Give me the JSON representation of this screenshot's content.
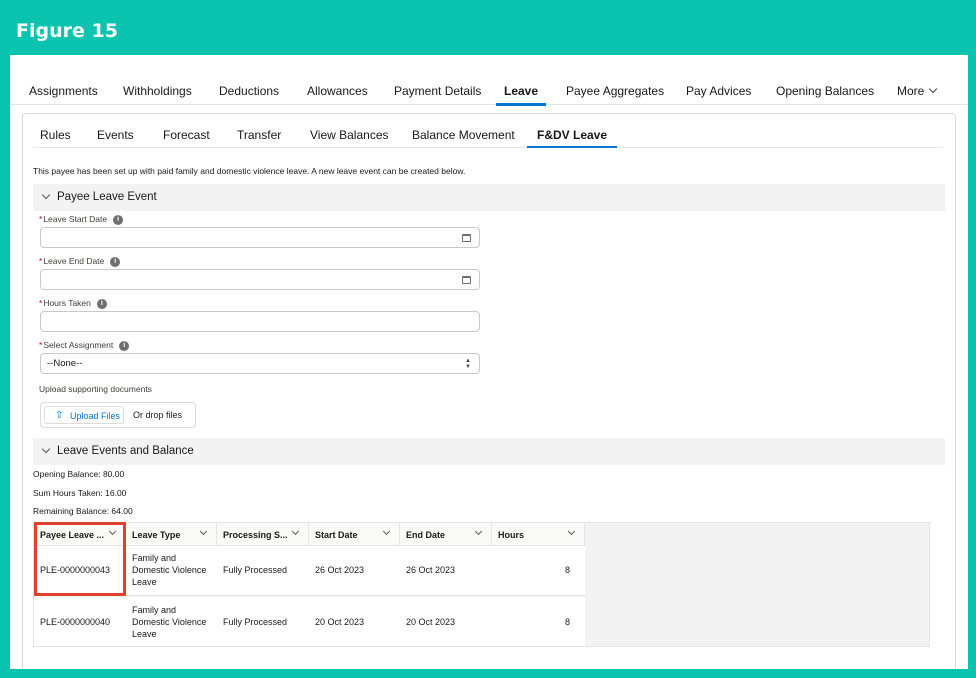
{
  "figure_title": "Figure 15",
  "top_tabs": [
    "Assignments",
    "Withholdings",
    "Deductions",
    "Allowances",
    "Payment Details",
    "Leave",
    "Payee Aggregates",
    "Pay Advices",
    "Opening Balances",
    "More"
  ],
  "active_top_tab": "Leave",
  "sub_tabs": [
    "Rules",
    "Events",
    "Forecast",
    "Transfer",
    "View Balances",
    "Balance Movement",
    "F&DV Leave"
  ],
  "active_sub_tab": "F&DV Leave",
  "intro_text": "This payee has been set up with paid family and domestic violence leave. A new leave event can be created below.",
  "section1_title": "Payee Leave Event",
  "fields": {
    "start_label": "Leave Start Date",
    "end_label": "Leave End Date",
    "hours_label": "Hours Taken",
    "assignment_label": "Select Assignment",
    "assignment_value": "--None--",
    "upload_label": "Upload supporting documents",
    "upload_button": "Upload Files",
    "drop_text": "Or drop files"
  },
  "section2_title": "Leave Events and Balance",
  "balances": {
    "opening": "Opening Balance: 80.00",
    "sum_taken": "Sum Hours Taken: 16.00",
    "remaining": "Remaining Balance: 64.00"
  },
  "table": {
    "columns": [
      "Payee Leave ...",
      "Leave Type",
      "Processing S...",
      "Start Date",
      "End Date",
      "Hours"
    ],
    "rows": [
      {
        "id": "PLE-0000000043",
        "type_lines": [
          "Family and",
          "Domestic Violence",
          "Leave"
        ],
        "status": "Fully Processed",
        "start": "26 Oct 2023",
        "end": "26 Oct 2023",
        "hours": "8"
      },
      {
        "id": "PLE-0000000040",
        "type_lines": [
          "Family and",
          "Domestic Violence",
          "Leave"
        ],
        "status": "Fully Processed",
        "start": "20 Oct 2023",
        "end": "20 Oct 2023",
        "hours": "8"
      }
    ]
  },
  "colors": {
    "accent": "#0176d3",
    "frame": "#0bc4b0",
    "highlight": "#e0412a",
    "required": "#ba0517"
  }
}
